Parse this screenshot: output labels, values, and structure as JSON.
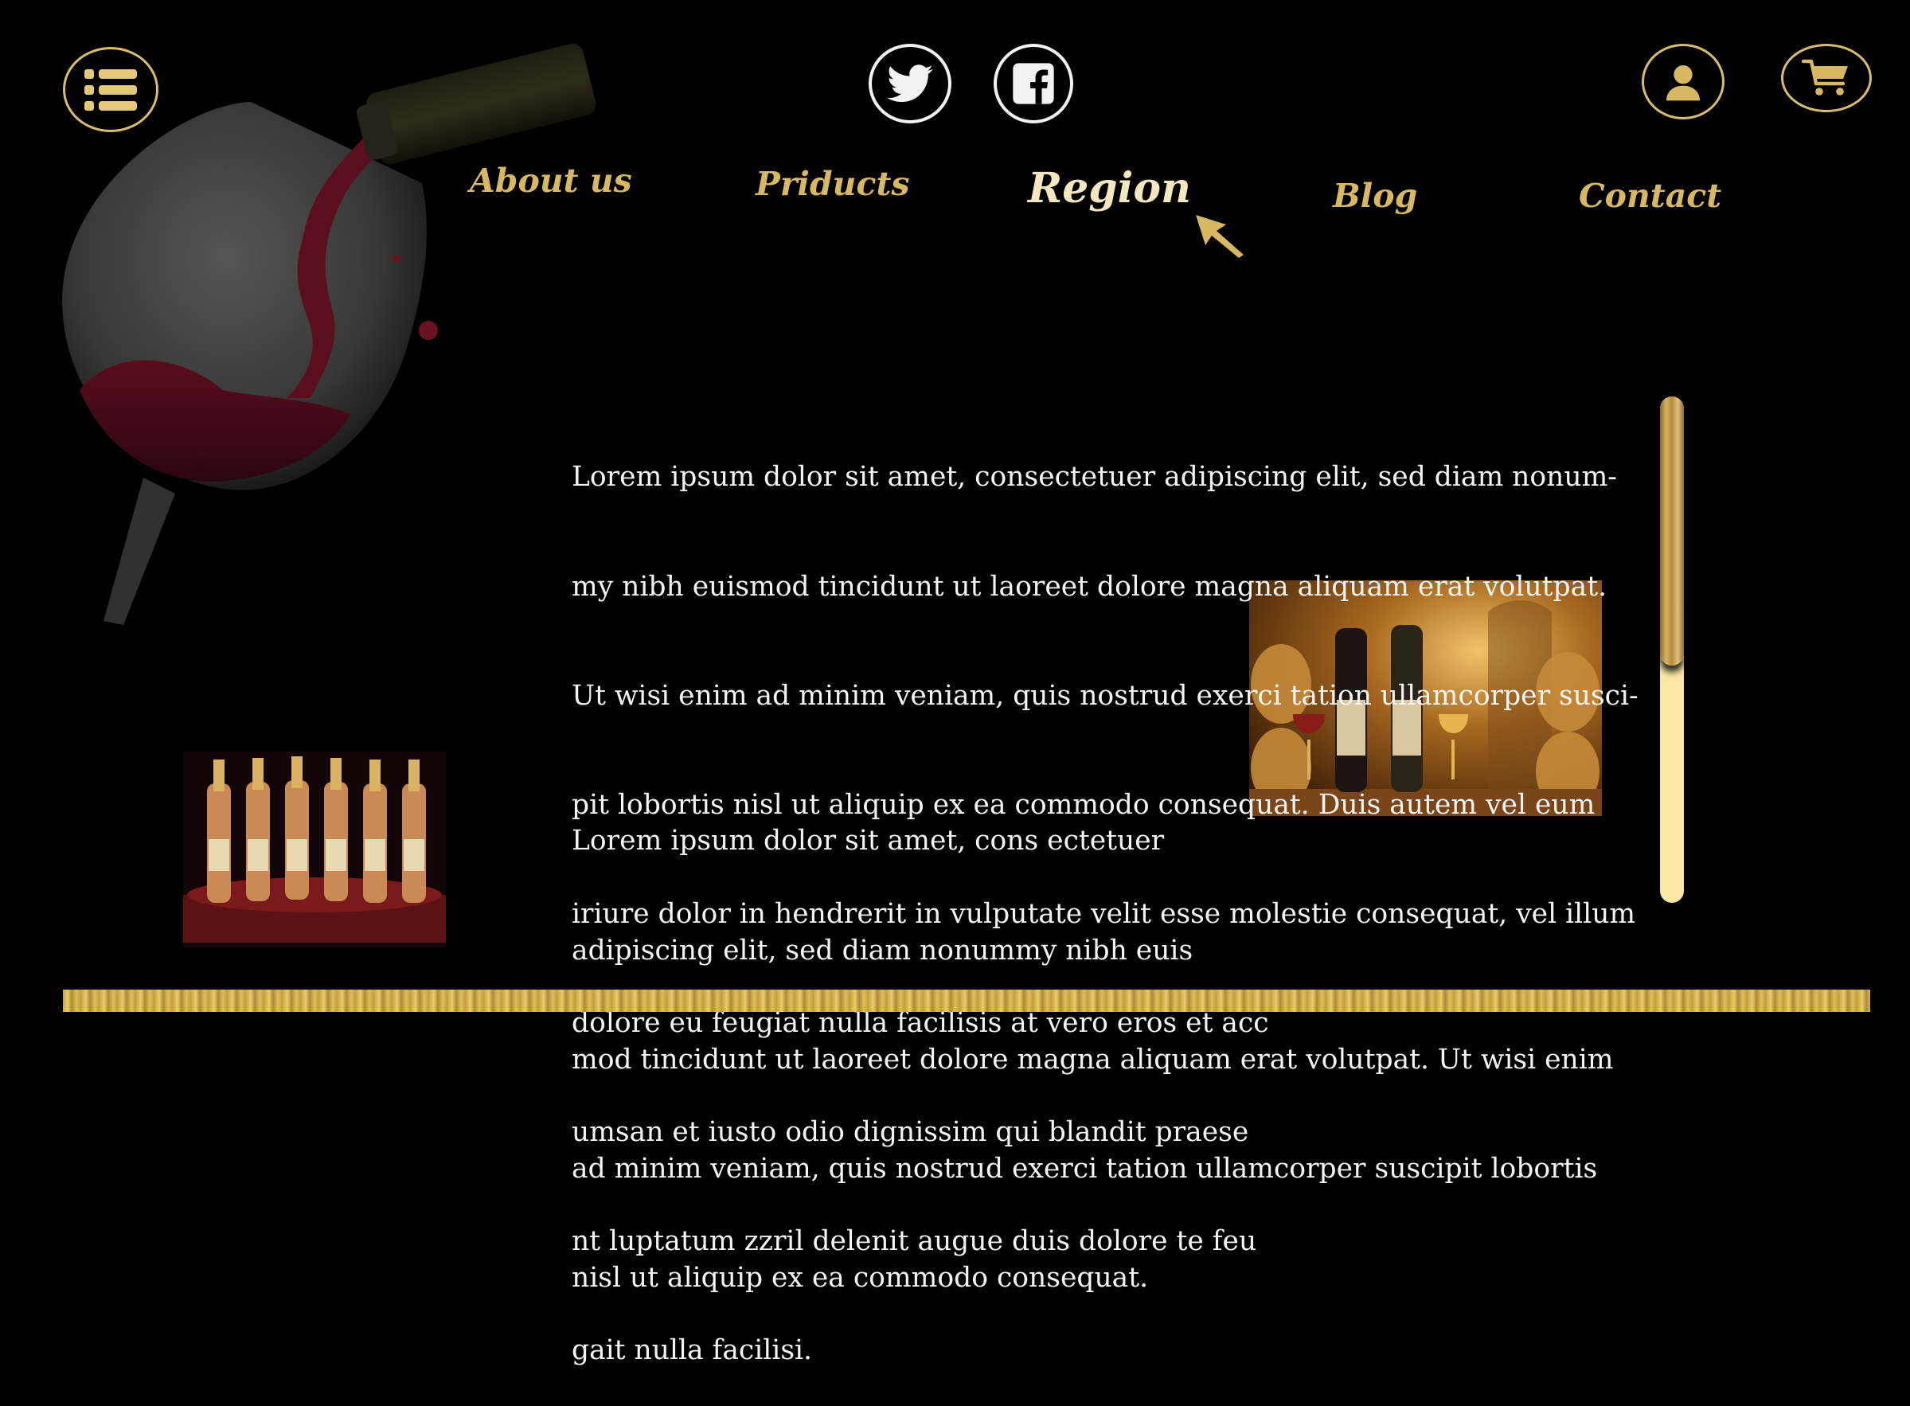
{
  "header": {
    "menu_icon": "list-menu-icon",
    "social": [
      {
        "name": "twitter-icon"
      },
      {
        "name": "facebook-icon"
      }
    ],
    "account_icon": "user-icon",
    "cart_icon": "cart-icon"
  },
  "nav": {
    "items": [
      {
        "label": "About us"
      },
      {
        "label": "Priducts"
      },
      {
        "label": "Region"
      },
      {
        "label": "Blog"
      },
      {
        "label": "Contact"
      }
    ],
    "active": "Region"
  },
  "content": {
    "p1_lines": [
      "Lorem ipsum dolor sit amet, consectetuer adipiscing elit, sed diam nonum-",
      "my nibh euismod tincidunt ut laoreet dolore magna aliquam erat volutpat.",
      "Ut wisi enim ad minim veniam, quis nostrud exerci tation ullamcorper susci-",
      "pit lobortis nisl ut aliquip ex ea commodo consequat. Duis autem vel eum",
      "iriure dolor in hendrerit in vulputate velit esse molestie consequat, vel illum",
      "dolore eu feugiat nulla facilisis at vero eros et acc",
      "umsan et iusto odio dignissim qui blandit praese",
      "nt luptatum zzril delenit augue duis dolore te feu",
      "gait nulla facilisi."
    ],
    "p2_lines": [
      "Lorem ipsum dolor sit amet, cons ectetuer",
      "adipiscing elit, sed diam nonummy nibh euis",
      "mod tincidunt ut laoreet dolore magna aliquam erat volutpat. Ut wisi enim",
      "ad minim veniam, quis nostrud exerci tation ullamcorper suscipit lobortis",
      "nisl ut aliquip ex ea commodo consequat."
    ]
  },
  "colors": {
    "background": "#000000",
    "gold": "#d8b861",
    "nav_active": "#f5e7c0",
    "text": "#f4f4f4",
    "scroll_track": "#f8e7a0"
  }
}
